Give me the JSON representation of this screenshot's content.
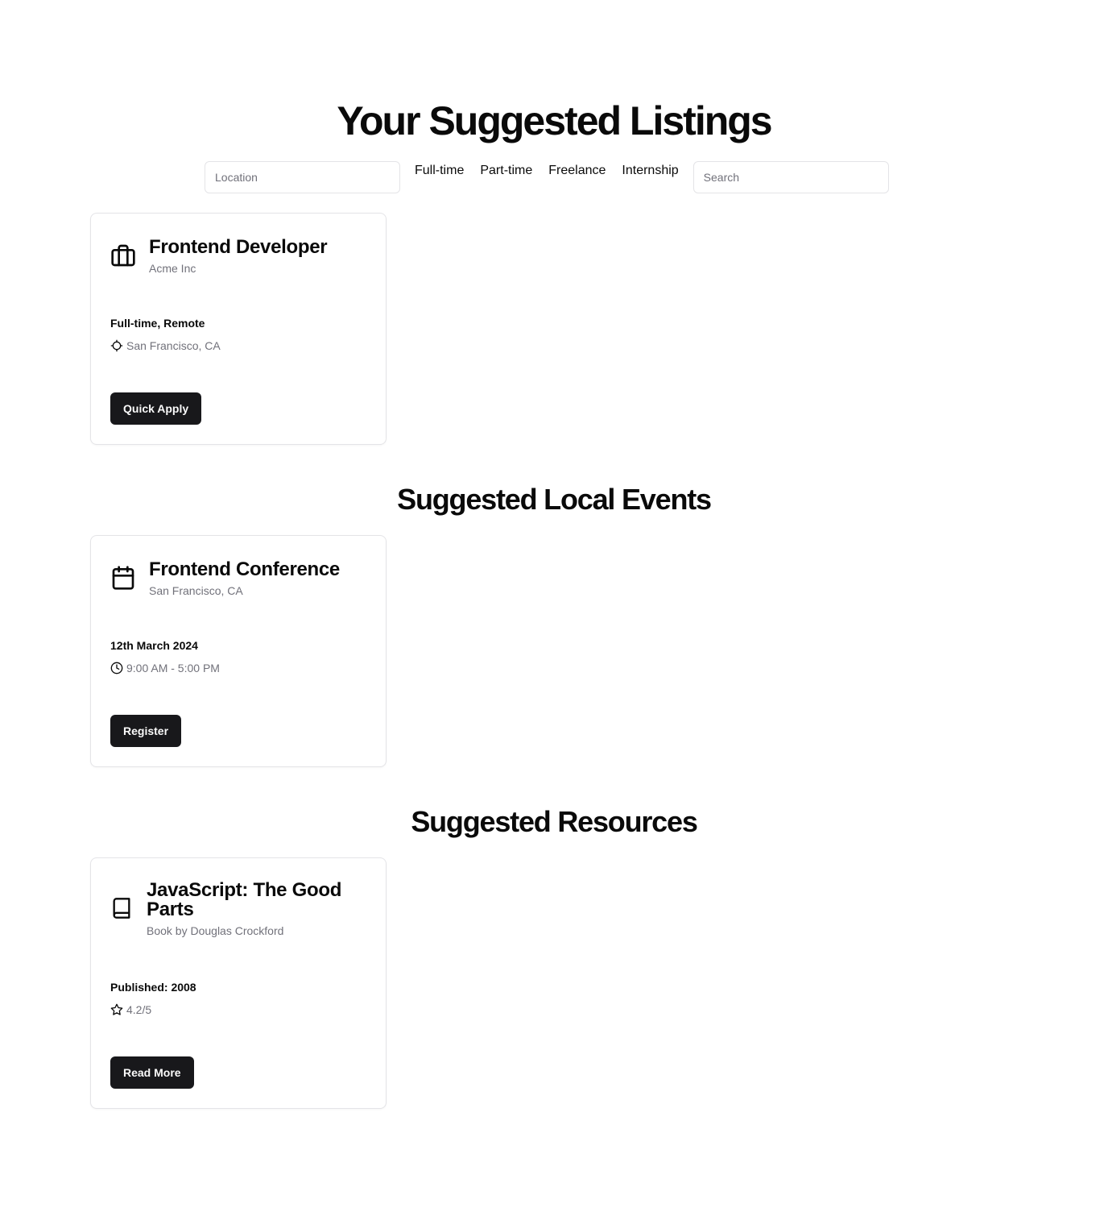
{
  "page": {
    "title": "Your Suggested Listings"
  },
  "filters": {
    "location_placeholder": "Location",
    "location_value": "",
    "job_types": [
      "Full-time",
      "Part-time",
      "Freelance",
      "Internship"
    ],
    "search_placeholder": "Search",
    "search_value": ""
  },
  "listings": {
    "job": {
      "icon": "briefcase-icon",
      "title": "Frontend Developer",
      "company": "Acme Inc",
      "type": "Full-time, Remote",
      "location_icon": "crosshair-icon",
      "location": "San Francisco, CA",
      "button_label": "Quick Apply"
    }
  },
  "events": {
    "section_title": "Suggested Local Events",
    "event": {
      "icon": "calendar-icon",
      "title": "Frontend Conference",
      "location": "San Francisco, CA",
      "date": "12th March 2024",
      "time_icon": "clock-icon",
      "time": "9:00 AM - 5:00 PM",
      "button_label": "Register"
    }
  },
  "resources": {
    "section_title": "Suggested Resources",
    "resource": {
      "icon": "book-icon",
      "title": "JavaScript: The Good Parts",
      "subtitle": "Book by Douglas Crockford",
      "published": "Published: 2008",
      "rating_icon": "star-icon",
      "rating": "4.2/5",
      "button_label": "Read More"
    }
  },
  "colors": {
    "text": "#0a0a0a",
    "muted": "#71717a",
    "border": "#e4e4e7",
    "button_bg": "#18181b",
    "button_text": "#fafafa"
  }
}
